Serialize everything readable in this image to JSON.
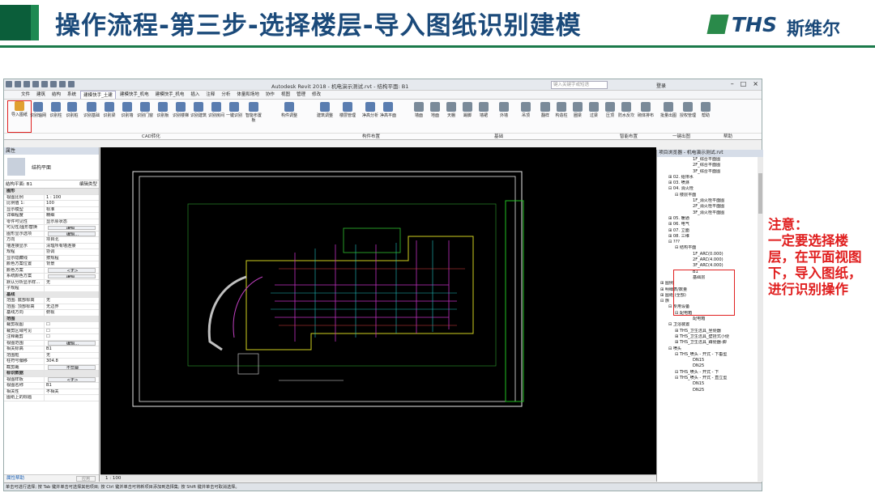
{
  "slide": {
    "title": "操作流程-第三步-选择楼层-导入图纸识别建模",
    "logo_text": "THS",
    "logo_cn": "斯维尔",
    "note_title": "注意：",
    "note_body": "一定要选择楼层，在平面视图下，导入图纸，进行识别操作"
  },
  "window": {
    "title": "Autodesk Revit 2018 -   机电演示测试.rvt - 结构平面: B1",
    "search_placeholder": "键入关键字或短语",
    "login": "登录"
  },
  "menu": [
    "文件",
    "建筑",
    "结构",
    "系统",
    "建模快手_土建",
    "建模快手_机电",
    "建模快手_机电",
    "插入",
    "注释",
    "分析",
    "体量和场地",
    "协作",
    "视图",
    "管理",
    "修改"
  ],
  "ribbon": {
    "buttons": [
      "导入图纸",
      "识别轴网",
      "识别柱",
      "识别桩",
      "识别基础",
      "识别梁",
      "识别墙",
      "识别门窗",
      "识别板",
      "识别楼梯",
      "识别建筑",
      "识别房间",
      "一键识别",
      "智能布置板",
      "构件调整",
      "建筑调整",
      "楼层管理",
      "净高分析",
      "净高平面",
      "墙面",
      "地面",
      "天棚",
      "踢脚",
      "墙裙",
      "外墙",
      "吊顶",
      "翻样",
      "构造柱",
      "圈梁",
      "过梁",
      "压顶",
      "防水反坎",
      "砌体排布",
      "批量出图",
      "授权管理",
      "帮助"
    ],
    "groups": [
      "CAD转化",
      "构件布置",
      "基础",
      "智能布置",
      "一键出图",
      "帮助"
    ]
  },
  "properties": {
    "header": "属性",
    "type_name": "结构平面",
    "filter_label": "结构平面: B1",
    "edit_type": "编辑类型",
    "rows": [
      {
        "k": "图形",
        "v": "",
        "sec": true
      },
      {
        "k": "视图比例",
        "v": "1 : 100"
      },
      {
        "k": "比例值 1:",
        "v": "100"
      },
      {
        "k": "显示模型",
        "v": "标准"
      },
      {
        "k": "详细程度",
        "v": "精细"
      },
      {
        "k": "零件可见性",
        "v": "显示原状态"
      },
      {
        "k": "可见性/图形替换",
        "v": "编辑...",
        "btn": true
      },
      {
        "k": "图形显示选项",
        "v": "编辑...",
        "btn": true
      },
      {
        "k": "方向",
        "v": "项目北"
      },
      {
        "k": "墙连接显示",
        "v": "清理所有墙连接"
      },
      {
        "k": "规程",
        "v": "协调"
      },
      {
        "k": "显示隐藏线",
        "v": "按规程"
      },
      {
        "k": "颜色方案位置",
        "v": "背景"
      },
      {
        "k": "颜色方案",
        "v": "<无>",
        "btn": true
      },
      {
        "k": "系统颜色方案",
        "v": "编辑...",
        "btn": true
      },
      {
        "k": "默认分析显示样...",
        "v": "无"
      },
      {
        "k": "子规程",
        "v": ""
      },
      {
        "k": "基线",
        "v": "",
        "sec": true
      },
      {
        "k": "范围: 底部标高",
        "v": "无"
      },
      {
        "k": "范围: 顶部标高",
        "v": "无边界"
      },
      {
        "k": "基线方向",
        "v": "俯视"
      },
      {
        "k": "范围",
        "v": "",
        "sec": true
      },
      {
        "k": "裁剪视图",
        "v": "☐"
      },
      {
        "k": "裁剪区域可见",
        "v": "☐"
      },
      {
        "k": "注释裁剪",
        "v": "☐"
      },
      {
        "k": "视图范围",
        "v": "编辑...",
        "btn": true
      },
      {
        "k": "相关标高",
        "v": "B1"
      },
      {
        "k": "范围框",
        "v": "无"
      },
      {
        "k": "柱符号偏移",
        "v": "304.8"
      },
      {
        "k": "截剪裁",
        "v": "不剪裁",
        "btn": true
      },
      {
        "k": "标识数据",
        "v": "",
        "sec": true
      },
      {
        "k": "视图样板",
        "v": "<无>",
        "btn": true
      },
      {
        "k": "视图名称",
        "v": "B1"
      },
      {
        "k": "相关性",
        "v": "不相关"
      },
      {
        "k": "图纸上的标题",
        "v": ""
      }
    ],
    "footer": "属性帮助",
    "apply": "应用"
  },
  "view_scale": "1 : 100",
  "status_hint": "单击可进行选择; 按 Tab 键并单击可选择其他项目; 按 Ctrl 键并单击可将新项目添加到选择集; 按 Shift 键并单击可取消选择。",
  "browser": {
    "title": "项目浏览器 - 机电演示测试.rvt",
    "items": [
      "1F_综合平面图",
      "2F_综合平面图",
      "3F_综合平面图",
      "⊞ 02. 给排水",
      "⊞ 03. 喷淋",
      "⊟ 04. 消火栓",
      "⊟ 楼层平面",
      "1F_消火栓平面图",
      "2F_消火栓平面图",
      "3F_消火栓平面图",
      "⊞ 05. 暖通",
      "⊞ 06. 电气",
      "⊞ 07. 立面",
      "⊞ 08. 三维",
      "⊟ ???",
      "⊟ 结构平面",
      "1F_ARC(0.000)",
      "2F_ARC(4.000)",
      "3F_ARC(4.000)",
      "B1",
      "基础层",
      "⊞ 图例",
      "⊞ 明细表/数量",
      "⊞ 图纸 (全部)",
      "⊟ 族",
      "⊟ 专用设备",
      "⊟ 配电箱",
      "配电箱",
      "⊟ 卫浴装置",
      "⊞ THS_卫生洁具_坐便器",
      "⊞ THS_卫生洁具_壁挂式小便",
      "⊞ THS_卫生洁具_蹲便器-脚",
      "⊟ 喷头",
      "⊟ THS_喷头 - 开式 - 下垂型",
      "DN15",
      "DN25",
      "⊟ THS_喷头 - 开式 - 下",
      "⊟ THS_喷头 - 开式 - 直立型",
      "DN15",
      "DN25"
    ]
  },
  "colors": {
    "title": "#1b4a7a",
    "accent": "#0b5e3a",
    "note": "#e02020"
  }
}
